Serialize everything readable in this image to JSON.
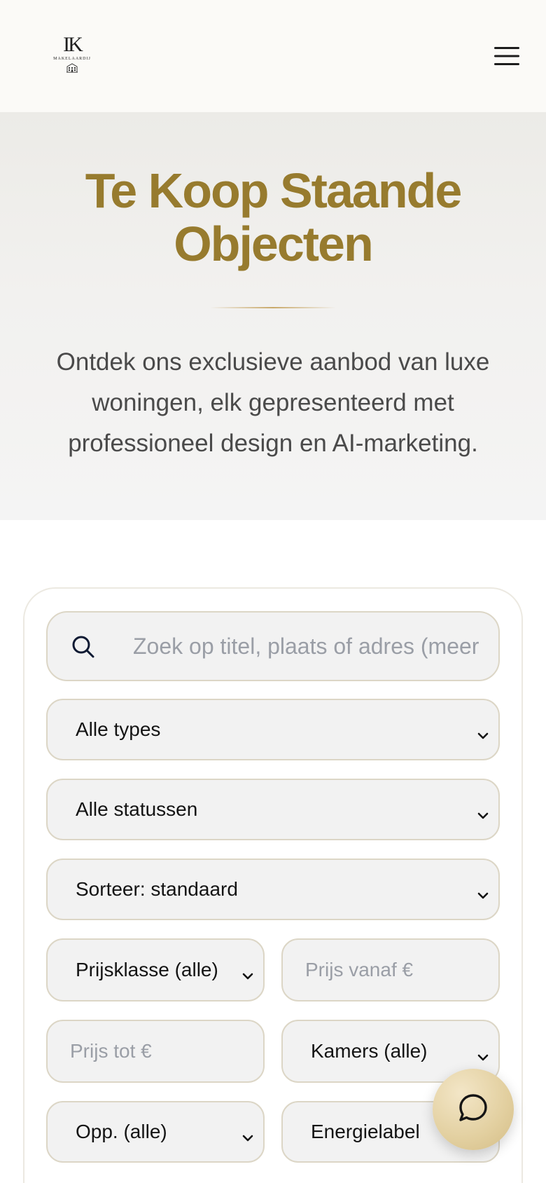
{
  "brand": {
    "logo_mark": "IK",
    "logo_text": "MAKELAARDIJ",
    "logo_sub": "GRONINGEN"
  },
  "hero": {
    "title_line1": "Te Koop Staande",
    "title_line2": "Objecten",
    "subtitle_line1": "Ontdek ons exclusieve aanbod van luxe",
    "subtitle_line2": "woningen, elk gepresenteerd met",
    "subtitle_line3": "professioneel design en AI-marketing.",
    "title_color": "#977b2e"
  },
  "filters": {
    "search_placeholder": "Zoek op titel, plaats of adres (meer",
    "type_value": "Alle types",
    "status_value": "Alle statussen",
    "sort_value": "Sorteer: standaard",
    "price_class_value": "Prijsklasse (alle)",
    "price_from_placeholder": "Prijs vanaf €",
    "price_to_placeholder": "Prijs tot €",
    "rooms_value": "Kamers (alle)",
    "area_value": "Opp. (alle)",
    "energy_value": "Energielabel"
  },
  "colors": {
    "accent": "#977b2e",
    "field_bg": "#f2f2f2",
    "field_border": "#dcd6c6",
    "chat_button": "#e2cf9f"
  },
  "icons": {
    "menu": "hamburger-menu-icon",
    "search": "search-icon",
    "chevron": "chevron-down-icon",
    "chat": "chat-bubble-icon"
  }
}
